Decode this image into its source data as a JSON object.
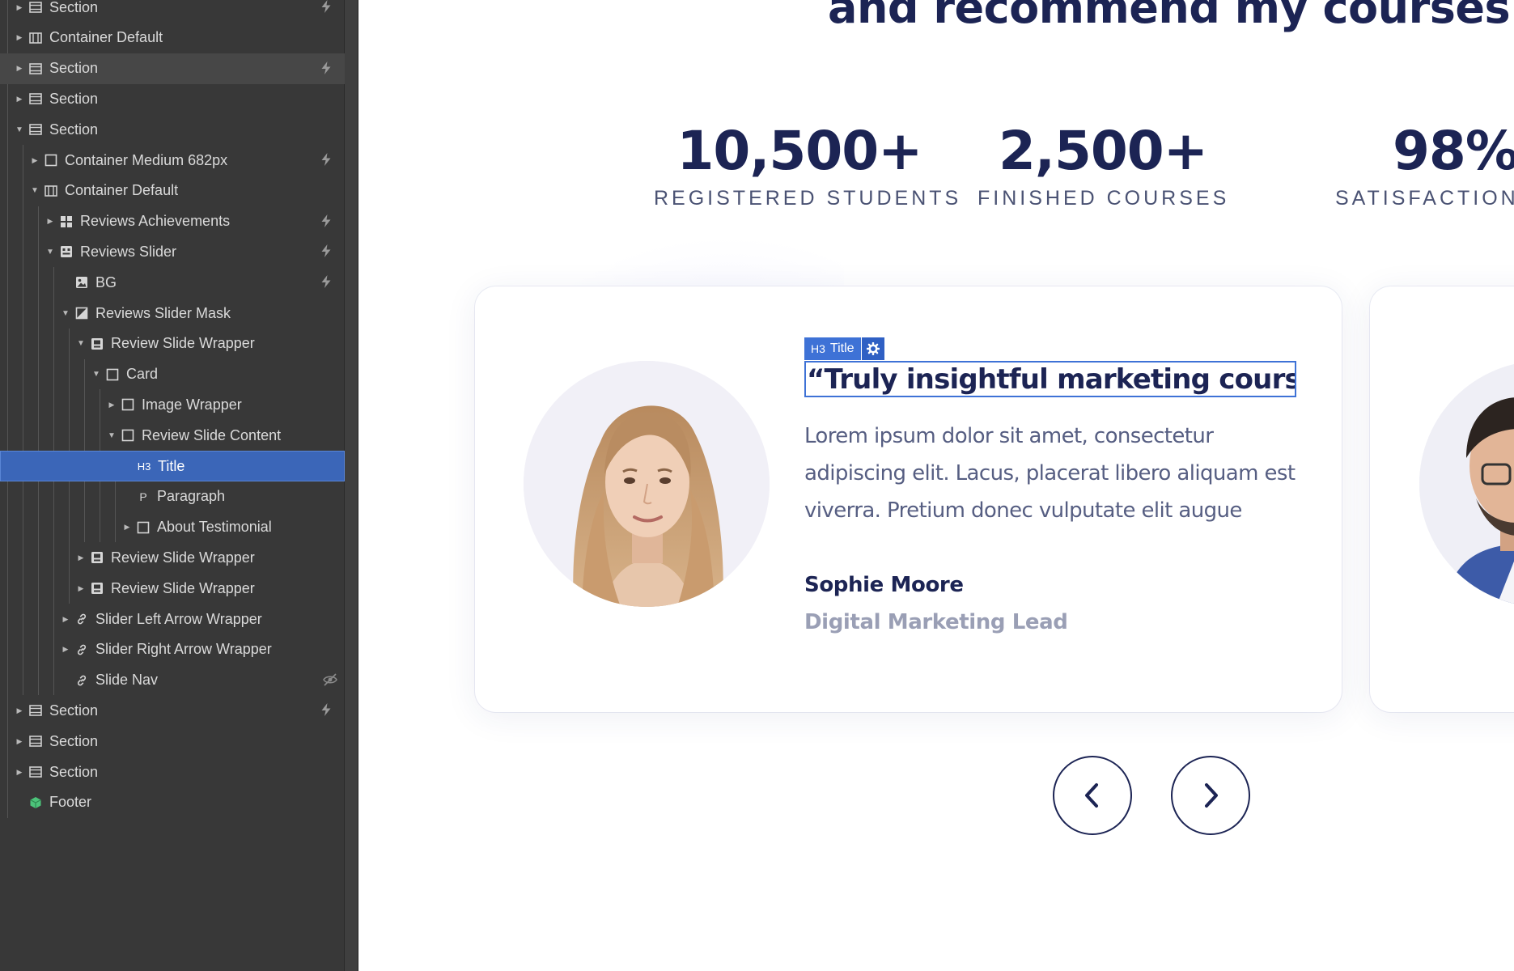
{
  "navigator": {
    "items": [
      {
        "label": "Section",
        "icon": "section-icon",
        "caret": "collapsed",
        "bolt": true
      },
      {
        "label": "Container Default",
        "icon": "container-icon",
        "caret": "collapsed",
        "bolt": false
      },
      {
        "label": "Section",
        "icon": "section-icon",
        "caret": "collapsed",
        "bolt": true
      },
      {
        "label": "Section",
        "icon": "section-icon",
        "caret": "collapsed",
        "bolt": false
      },
      {
        "label": "Section",
        "icon": "section-icon",
        "caret": "expanded",
        "bolt": false
      },
      {
        "label": "Container Medium 682px",
        "icon": "box-icon",
        "caret": "collapsed",
        "bolt": true
      },
      {
        "label": "Container Default",
        "icon": "container-icon",
        "caret": "expanded",
        "bolt": false
      },
      {
        "label": "Reviews Achievements",
        "icon": "grid-icon",
        "caret": "collapsed",
        "bolt": true
      },
      {
        "label": "Reviews Slider",
        "icon": "slider-icon",
        "caret": "expanded",
        "bolt": true
      },
      {
        "label": "BG",
        "icon": "image-icon",
        "caret": "none",
        "bolt": true
      },
      {
        "label": "Reviews Slider Mask",
        "icon": "mask-icon",
        "caret": "expanded",
        "bolt": false
      },
      {
        "label": "Review Slide Wrapper",
        "icon": "slide-icon",
        "caret": "expanded",
        "bolt": false
      },
      {
        "label": "Card",
        "icon": "box-icon",
        "caret": "expanded",
        "bolt": false
      },
      {
        "label": "Image Wrapper",
        "icon": "box-icon",
        "caret": "collapsed",
        "bolt": false
      },
      {
        "label": "Review Slide Content",
        "icon": "box-icon",
        "caret": "expanded",
        "bolt": false
      },
      {
        "label": "Title",
        "icon": "h3-icon",
        "caret": "none",
        "bolt": false
      },
      {
        "label": "Paragraph",
        "icon": "paragraph-icon",
        "caret": "none",
        "bolt": false
      },
      {
        "label": "About Testimonial",
        "icon": "box-icon",
        "caret": "collapsed",
        "bolt": false
      },
      {
        "label": "Review Slide Wrapper",
        "icon": "slide-icon",
        "caret": "collapsed",
        "bolt": false
      },
      {
        "label": "Review Slide Wrapper",
        "icon": "slide-icon",
        "caret": "collapsed",
        "bolt": false
      },
      {
        "label": "Slider Left Arrow Wrapper",
        "icon": "link-icon",
        "caret": "collapsed",
        "bolt": false
      },
      {
        "label": "Slider Right Arrow Wrapper",
        "icon": "link-icon",
        "caret": "collapsed",
        "bolt": false
      },
      {
        "label": "Slide Nav",
        "icon": "link-icon",
        "caret": "none",
        "bolt": false,
        "hidden": true
      },
      {
        "label": "Section",
        "icon": "section-icon",
        "caret": "collapsed",
        "bolt": true
      },
      {
        "label": "Section",
        "icon": "section-icon",
        "caret": "collapsed",
        "bolt": false
      },
      {
        "label": "Section",
        "icon": "section-icon",
        "caret": "collapsed",
        "bolt": false
      },
      {
        "label": "Footer",
        "icon": "component-icon",
        "caret": "none",
        "bolt": false
      }
    ],
    "hovered_index": 2,
    "selected_index": 15
  },
  "page": {
    "heading": "and recommend my courses",
    "stats": [
      {
        "value": "10,500+",
        "label": "REGISTERED STUDENTS"
      },
      {
        "value": "2,500+",
        "label": "FINISHED COURSES"
      },
      {
        "value": "98%",
        "label": "SATISFACTION RATE"
      }
    ],
    "review": {
      "title_tag_level": "H3",
      "title_tag_label": "Title",
      "title": "“Truly insightful marketing courses”",
      "text_lines": [
        "Lorem ipsum dolor sit amet, consectetur",
        "adipiscing elit. Lacus, placerat libero aliquam est",
        "viverra. Pretium donec vulputate elit augue"
      ],
      "name": "Sophie Moore",
      "role": "Digital Marketing Lead"
    }
  },
  "colors": {
    "navigator_bg": "#383838",
    "selection": "#3b66b8",
    "heading": "#1c2454",
    "body_text": "#565e82",
    "muted": "#9a9fb5",
    "accent_blue": "#3e72d6",
    "component_green": "#4cc47a"
  }
}
